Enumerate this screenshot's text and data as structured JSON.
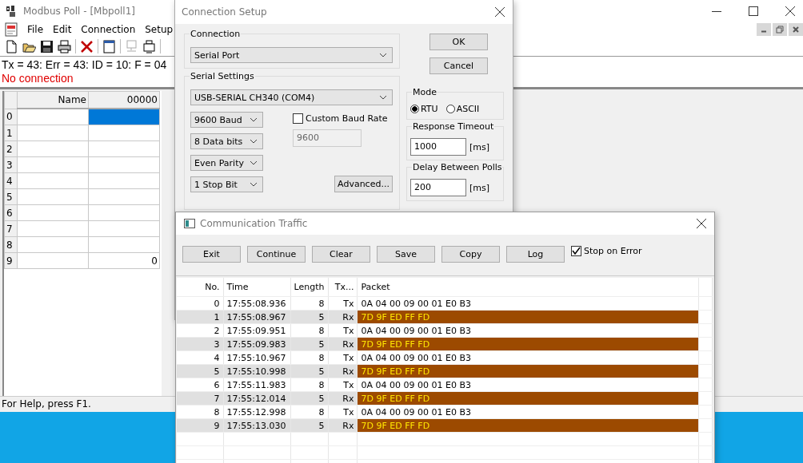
{
  "main_window": {
    "title": "Modbus Poll - [Mbpoll1]",
    "menu": [
      "File",
      "Edit",
      "Connection",
      "Setup"
    ],
    "status_line": "Tx = 43: Err = 43: ID = 10: F = 04",
    "error": "No connection",
    "grid": {
      "columns": [
        "Name",
        "00000"
      ],
      "rows": [
        {
          "label": "0",
          "selected": true
        },
        {
          "label": "1",
          "selected": false
        },
        {
          "label": "2",
          "selected": false
        },
        {
          "label": "3",
          "selected": false
        },
        {
          "label": "4",
          "selected": false
        },
        {
          "label": "5",
          "selected": false
        },
        {
          "label": "6",
          "selected": false
        },
        {
          "label": "7",
          "selected": false
        },
        {
          "label": "8",
          "selected": false
        },
        {
          "label": "9",
          "value": "0",
          "selected": false
        }
      ]
    },
    "status_bar": "For Help, press F1."
  },
  "connection_dialog": {
    "title": "Connection Setup",
    "connection": {
      "label": "Connection",
      "value": "Serial Port"
    },
    "serial_settings": {
      "label": "Serial Settings",
      "port": "USB-SERIAL CH340 (COM4)",
      "combos": [
        "9600 Baud",
        "8 Data bits",
        "Even Parity",
        "1 Stop Bit"
      ],
      "custom_baud": {
        "label": "Custom Baud Rate",
        "checked": false
      },
      "custom_baud_value": {
        "value": "9600",
        "disabled": true
      },
      "advanced": "Advanced..."
    },
    "buttons": [
      "OK",
      "Cancel"
    ],
    "mode": {
      "label": "Mode",
      "options": [
        {
          "label": "RTU",
          "selected": true
        },
        {
          "label": "ASCII",
          "selected": false
        }
      ]
    },
    "response_timeout": {
      "label": "Response Timeout",
      "value": "1000",
      "unit": "[ms]"
    },
    "delay": {
      "label": "Delay Between Polls",
      "value": "200",
      "unit": "[ms]"
    }
  },
  "traffic_window": {
    "title": "Communication Traffic",
    "buttons": [
      "Exit",
      "Continue",
      "Clear",
      "Save",
      "Copy",
      "Log"
    ],
    "stop_on_error": {
      "label": "Stop on Error",
      "checked": true
    },
    "columns": [
      "No.",
      "Time",
      "Length",
      "Tx...",
      "Packet"
    ],
    "rows": [
      {
        "no": "0",
        "time": "17:55:08.936",
        "length": "8",
        "dir": "Tx",
        "packet": "0A 04 00 09 00 01 E0 B3",
        "kind": "tx"
      },
      {
        "no": "1",
        "time": "17:55:08.967",
        "length": "5",
        "dir": "Rx",
        "packet": "7D 9F ED FF FD",
        "kind": "rx"
      },
      {
        "no": "2",
        "time": "17:55:09.951",
        "length": "8",
        "dir": "Tx",
        "packet": "0A 04 00 09 00 01 E0 B3",
        "kind": "tx"
      },
      {
        "no": "3",
        "time": "17:55:09.983",
        "length": "5",
        "dir": "Rx",
        "packet": "7D 9F ED FF FD",
        "kind": "rx"
      },
      {
        "no": "4",
        "time": "17:55:10.967",
        "length": "8",
        "dir": "Tx",
        "packet": "0A 04 00 09 00 01 E0 B3",
        "kind": "tx"
      },
      {
        "no": "5",
        "time": "17:55:10.998",
        "length": "5",
        "dir": "Rx",
        "packet": "7D 9F ED FF FD",
        "kind": "rx"
      },
      {
        "no": "6",
        "time": "17:55:11.983",
        "length": "8",
        "dir": "Tx",
        "packet": "0A 04 00 09 00 01 E0 B3",
        "kind": "tx"
      },
      {
        "no": "7",
        "time": "17:55:12.014",
        "length": "5",
        "dir": "Rx",
        "packet": "7D 9F ED FF FD",
        "kind": "rx"
      },
      {
        "no": "8",
        "time": "17:55:12.998",
        "length": "8",
        "dir": "Tx",
        "packet": "0A 04 00 09 00 01 E0 B3",
        "kind": "tx"
      },
      {
        "no": "9",
        "time": "17:55:13.030",
        "length": "5",
        "dir": "Rx",
        "packet": "7D 9F ED FF FD",
        "kind": "rx"
      }
    ]
  }
}
